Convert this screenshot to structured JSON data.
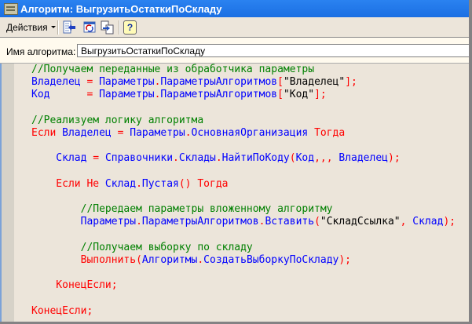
{
  "window": {
    "title": "Алгоритм: ВыгрузитьОстаткиПоСкладу"
  },
  "toolbar": {
    "actions_label": "Действия",
    "buttons": [
      {
        "icon": "move-left-icon"
      },
      {
        "icon": "refresh-icon"
      },
      {
        "icon": "swap-icon"
      },
      {
        "icon": "help-icon",
        "text": "?"
      }
    ]
  },
  "name_field": {
    "label": "Имя алгоритма:",
    "value": "ВыгрузитьОстаткиПоСкладу"
  },
  "colors": {
    "comment": "#008000",
    "keyword": "#ff0000",
    "identifier": "#0000ff",
    "string": "#000000",
    "title_bar": "#1b6fe3"
  },
  "code_lines": [
    [
      [
        "//Получаем переданные из обработчика параметры",
        "c"
      ]
    ],
    [
      [
        "Владелец ",
        "i"
      ],
      [
        "= ",
        "k"
      ],
      [
        "Параметры",
        "i"
      ],
      [
        ".",
        "k"
      ],
      [
        "ПараметрыАлгоритмов",
        "i"
      ],
      [
        "[",
        "k"
      ],
      [
        "\"Владелец\"",
        "s"
      ],
      [
        "];",
        "k"
      ]
    ],
    [
      [
        "Код      ",
        "i"
      ],
      [
        "= ",
        "k"
      ],
      [
        "Параметры",
        "i"
      ],
      [
        ".",
        "k"
      ],
      [
        "ПараметрыАлгоритмов",
        "i"
      ],
      [
        "[",
        "k"
      ],
      [
        "\"Код\"",
        "s"
      ],
      [
        "];",
        "k"
      ]
    ],
    [],
    [
      [
        "//Реализуем логику алгоритма",
        "c"
      ]
    ],
    [
      [
        "Если ",
        "k"
      ],
      [
        "Владелец ",
        "i"
      ],
      [
        "= ",
        "k"
      ],
      [
        "Параметры",
        "i"
      ],
      [
        ".",
        "k"
      ],
      [
        "ОсновнаяОрганизация ",
        "i"
      ],
      [
        "Тогда",
        "k"
      ]
    ],
    [],
    [
      [
        "    Склад ",
        "i"
      ],
      [
        "= ",
        "k"
      ],
      [
        "Справочники",
        "i"
      ],
      [
        ".",
        "k"
      ],
      [
        "Склады",
        "i"
      ],
      [
        ".",
        "k"
      ],
      [
        "НайтиПоКоду",
        "i"
      ],
      [
        "(",
        "k"
      ],
      [
        "Код",
        "i"
      ],
      [
        ",,, ",
        "k"
      ],
      [
        "Владелец",
        "i"
      ],
      [
        ");",
        "k"
      ]
    ],
    [],
    [
      [
        "    Если Не ",
        "k"
      ],
      [
        "Склад",
        "i"
      ],
      [
        ".",
        "k"
      ],
      [
        "Пустая",
        "i"
      ],
      [
        "() Тогда",
        "k"
      ]
    ],
    [],
    [
      [
        "        //Передаем параметры вложенному алгоритму",
        "c"
      ]
    ],
    [
      [
        "        Параметры",
        "i"
      ],
      [
        ".",
        "k"
      ],
      [
        "ПараметрыАлгоритмов",
        "i"
      ],
      [
        ".",
        "k"
      ],
      [
        "Вставить",
        "i"
      ],
      [
        "(",
        "k"
      ],
      [
        "\"СкладСсылка\"",
        "s"
      ],
      [
        ", ",
        "k"
      ],
      [
        "Склад",
        "i"
      ],
      [
        ");",
        "k"
      ]
    ],
    [],
    [
      [
        "        //Получаем выборку по складу",
        "c"
      ]
    ],
    [
      [
        "        Выполнить",
        "k"
      ],
      [
        "(",
        "k"
      ],
      [
        "Алгоритмы",
        "i"
      ],
      [
        ".",
        "k"
      ],
      [
        "СоздатьВыборкуПоСкладу",
        "i"
      ],
      [
        ");",
        "k"
      ]
    ],
    [],
    [
      [
        "    КонецЕсли;",
        "k"
      ]
    ],
    [],
    [
      [
        "КонецЕсли;",
        "k"
      ]
    ]
  ]
}
